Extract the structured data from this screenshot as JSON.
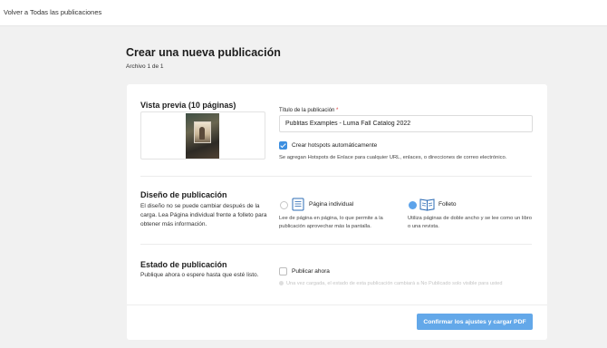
{
  "topbar": {
    "back_label": "Volver a Todas las publicaciones"
  },
  "header": {
    "title": "Crear una nueva publicación",
    "file_count": "Archivo 1 de 1"
  },
  "preview": {
    "title": "Vista previa (10 páginas)"
  },
  "title_field": {
    "label": "Título de la publicación",
    "required_mark": "*",
    "value": "Publitas Examples - Luma Fall Catalog 2022"
  },
  "hotspots": {
    "label": "Crear hotspots automáticamente",
    "checked": true,
    "hint": "Se agregan Hotspots de Enlace para cualquier URL, enlaces, o direcciones de correo electrónico."
  },
  "layout": {
    "title": "Diseño de publicación",
    "description": "El diseño no se puede cambiar después de la carga. Lea Página individual frente a folleto para obtener más información.",
    "options": [
      {
        "label": "Página individual",
        "hint": "Lee de página en página, lo que permite a la publicación aprovechar más la pantalla.",
        "selected": false,
        "icon": "single-page-icon"
      },
      {
        "label": "Folleto",
        "hint": "Utiliza páginas de doble ancho y se lee como un libro o una revista.",
        "selected": true,
        "icon": "booklet-icon"
      }
    ]
  },
  "status": {
    "title": "Estado de publicación",
    "description": "Publique ahora o espere hasta que esté listo.",
    "publish_now_label": "Publicar ahora",
    "publish_now_checked": false,
    "disabled_note": "Una vez cargada, el estado de esta publicación cambiará a No Publicado solo visible para usted"
  },
  "footer": {
    "confirm_label": "Confirmar los ajustes y cargar PDF"
  },
  "colors": {
    "accent": "#3d8fe0",
    "button": "#63a8e9",
    "page_bg": "#f1f1f1"
  }
}
